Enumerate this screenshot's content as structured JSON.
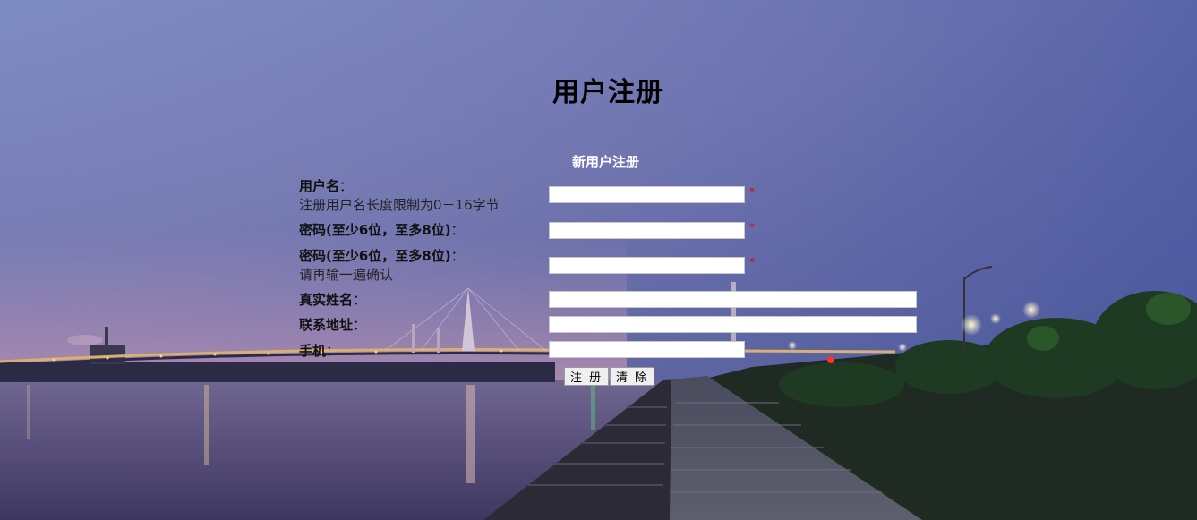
{
  "page_title": "用户注册",
  "form_subtitle": "新用户注册",
  "required_mark": "*",
  "fields": {
    "username": {
      "label": "用户名",
      "colon": "：",
      "hint": "注册用户名长度限制为0－16字节",
      "value": ""
    },
    "password": {
      "label": "密码(至少6位，至多8位)",
      "colon": "：",
      "value": ""
    },
    "password_confirm": {
      "label": "密码(至少6位，至多8位)",
      "colon": "：",
      "hint": "请再输一遍确认",
      "value": ""
    },
    "realname": {
      "label": "真实姓名",
      "colon": "：",
      "value": ""
    },
    "address": {
      "label": "联系地址",
      "colon": "：",
      "value": ""
    },
    "phone": {
      "label": "手机",
      "colon": "：",
      "value": ""
    }
  },
  "buttons": {
    "submit": "注 册",
    "reset": "清 除"
  },
  "colors": {
    "required": "#e00000",
    "subtitle": "#ffffff"
  }
}
